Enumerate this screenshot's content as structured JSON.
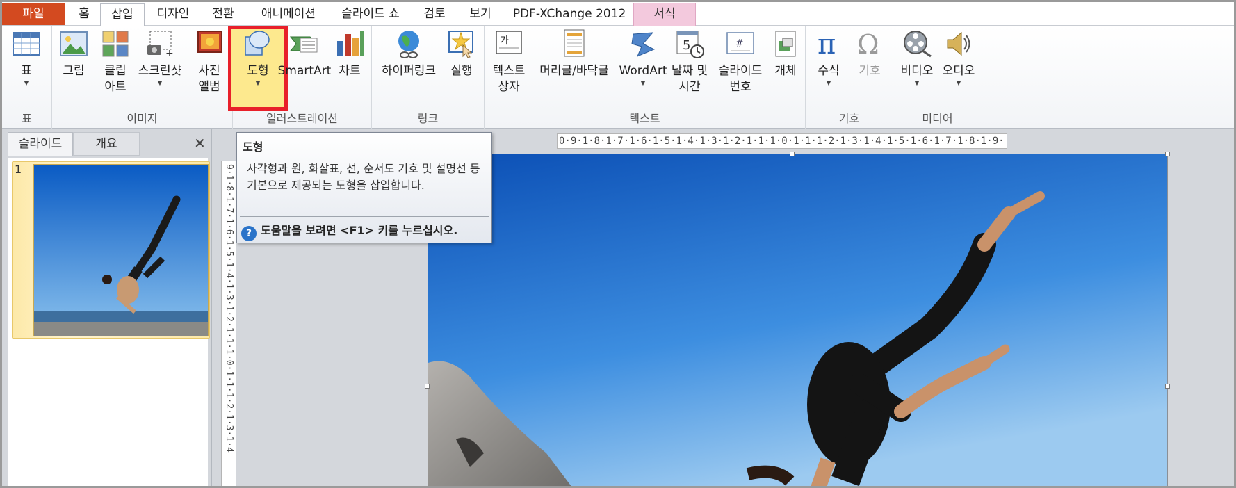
{
  "tabs": {
    "file": "파일",
    "home": "홈",
    "insert": "삽입",
    "design": "디자인",
    "transitions": "전환",
    "animations": "애니메이션",
    "slideshow": "슬라이드 쇼",
    "review": "검토",
    "view": "보기",
    "pdfxchange": "PDF-XChange 2012",
    "format": "서식"
  },
  "ribbon": {
    "table_group": {
      "label": "표",
      "table": "표"
    },
    "image_group": {
      "label": "이미지",
      "picture": "그림",
      "clipart_1": "클립",
      "clipart_2": "아트",
      "screenshot": "스크린샷",
      "album_1": "사진",
      "album_2": "앨범"
    },
    "illustration_group": {
      "label": "일러스트레이션",
      "shapes": "도형",
      "smartart": "SmartArt",
      "chart": "차트"
    },
    "link_group": {
      "label": "링크",
      "hyperlink": "하이퍼링크",
      "action": "실행"
    },
    "text_group": {
      "label": "텍스트",
      "textbox_1": "텍스트",
      "textbox_2": "상자",
      "headerfooter": "머리글/바닥글",
      "wordart": "WordArt",
      "datetime_1": "날짜 및",
      "datetime_2": "시간",
      "slidenum_1": "슬라이드",
      "slidenum_2": "번호",
      "object": "개체"
    },
    "symbol_group": {
      "label": "기호",
      "equation": "수식",
      "symbol": "기호"
    },
    "media_group": {
      "label": "미디어",
      "video": "비디오",
      "audio": "오디오"
    }
  },
  "pane": {
    "tab_slides": "슬라이드",
    "tab_outline": "개요",
    "close": "✕",
    "slide_number": "1"
  },
  "tooltip": {
    "title": "도형",
    "body": "사각형과 원, 화살표, 선, 순서도 기호 및 설명선 등 기본으로 제공되는 도형을 삽입합니다.",
    "help": "도움말을 보려면 <F1> 키를 누르십시오.",
    "help_icon": "?"
  },
  "ruler": {
    "horizontal": "0·9·1·8·1·7·1·6·1·5·1·4·1·3·1·2·1·1·1·0·1·1·1·2·1·3·1·4·1·5·1·6·1·7·1·8·1·9·",
    "vertical": "9·1·8·1·7·1·6·1·5·1·4·1·3·1·2·1·1·1·0·1·1·1·2·1·3·1·4"
  },
  "icons": {
    "table": "table-icon",
    "picture": "picture-icon",
    "clipart": "clipart-icon",
    "screenshot": "screenshot-icon",
    "album": "photo-album-icon",
    "shapes": "shapes-icon",
    "smartart": "smartart-icon",
    "chart": "chart-icon",
    "hyperlink": "globe-link-icon",
    "action": "star-cursor-icon",
    "textbox": "textbox-icon",
    "headerfooter": "header-footer-icon",
    "wordart": "wordart-icon",
    "datetime": "calendar-clock-icon",
    "slidenum": "slide-number-icon",
    "object": "object-icon",
    "equation": "pi-icon",
    "symbol": "omega-icon",
    "video": "film-reel-icon",
    "audio": "speaker-icon"
  },
  "colors": {
    "file_tab": "#d34a20",
    "format_tab": "#f3c9dd",
    "highlight_border": "#e8202a",
    "highlight_fill": "#fde98e"
  }
}
